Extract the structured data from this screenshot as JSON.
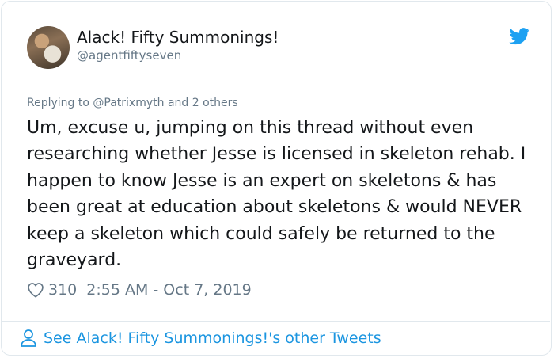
{
  "author": {
    "name": "Alack! Fifty Summonings!",
    "handle": "@agentfiftyseven"
  },
  "reply": {
    "prefix": "Replying to",
    "mention": "@Patrixmyth",
    "suffix": "and 2 others"
  },
  "tweet_text": "Um, excuse u, jumping on this thread without even researching whether Jesse is licensed in skeleton rehab. I happen to know Jesse is an expert on skeletons & has been great at education about skeletons & would NEVER keep a skeleton which could safely be returned to the graveyard.",
  "meta": {
    "likes": "310",
    "timestamp": "2:55 AM - Oct 7, 2019"
  },
  "footer": {
    "link_text": "See Alack! Fifty Summonings!'s other Tweets"
  },
  "icons": {
    "brand": "twitter-bird-icon",
    "like": "heart-icon",
    "profile": "person-icon"
  },
  "colors": {
    "brand_blue": "#1da1f2",
    "link_blue": "#1b95e0",
    "muted": "#657786",
    "text": "#14171a"
  }
}
